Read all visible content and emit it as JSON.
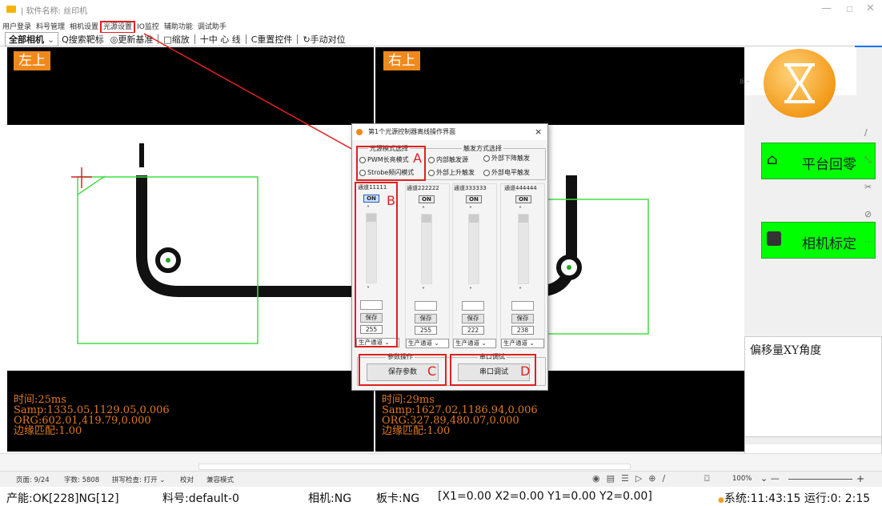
{
  "window": {
    "title": "|  软件名称: 丝印机"
  },
  "menu": [
    "用户登录",
    "料号管理",
    "相机设置",
    "光源设置",
    "IO监控",
    "辅助功能",
    "调试助手"
  ],
  "menu_active_index": 3,
  "toolbar": {
    "camera_select": "全部相机",
    "search_target": "Q搜索靶标",
    "update_base": "◎更新基准",
    "zoom": "□缩放",
    "center_line": "十中 心 线",
    "reset_ctrl": "C重置控件",
    "manual_align": "手动对位"
  },
  "cam_left": {
    "tag": "左上",
    "time": "时间:25ms",
    "samp": "Samp:1335.05,1129.05,0.006",
    "org": "ORG:602.01,419.79,0.000",
    "edge": "边缘匹配:1.00"
  },
  "cam_right": {
    "tag": "右上",
    "time": "时间:29ms",
    "samp": "Samp:1627.02,1186.94,0.006",
    "org": "ORG:327.89,480.07,0.000",
    "edge": "边缘匹配:1.00"
  },
  "right_panel": {
    "partial_label": "板 -",
    "btn_home": "平台回零",
    "btn_calib": "相机标定",
    "offset_title": "偏移量XY角度"
  },
  "dialog": {
    "title": "第1个光源控制器离线操作界面",
    "close": "×",
    "mode_group": "光源模式选择",
    "mode_pwm": "PWM长亮模式",
    "mode_strobe": "Strobe频闪模式",
    "trigger_group": "触发方式选择",
    "trig_internal": "内部触发源",
    "trig_falling": "外部下降触发",
    "trig_rising": "外部上升触发",
    "trig_level": "外部电平触发",
    "channels": [
      {
        "name": "通道11111",
        "on": "ON",
        "save": "保存",
        "value": "255",
        "prod": "生产通道"
      },
      {
        "name": "通道222222",
        "on": "ON",
        "save": "保存",
        "value": "255",
        "prod": "生产通道"
      },
      {
        "name": "通道333333",
        "on": "ON",
        "save": "保存",
        "value": "222",
        "prod": "生产通道"
      },
      {
        "name": "通道444444",
        "on": "ON",
        "save": "保存",
        "value": "238",
        "prod": "生产通道"
      }
    ],
    "param_group": "参数操作",
    "save_params": "保存参数",
    "serial_group": "串口调试",
    "serial_debug": "串口调试"
  },
  "annotations": {
    "a": "A",
    "b": "B",
    "c": "C",
    "d": "D"
  },
  "statusbar": {
    "page": "页面: 9/24",
    "words": "字数: 5808",
    "spell": "拼写检查: 打开",
    "proof": "校对",
    "compat": "兼容模式",
    "zoom": "100%"
  },
  "bottombar": {
    "result": "产能:OK[228]NG[12]",
    "material": "料号:default-0",
    "camera": "相机:NG",
    "card": "板卡:NG",
    "coords": "[X1=0.00 X2=0.00 Y1=0.00 Y2=0.00]",
    "system": "系统:11:43:15 运行:0: 2:15"
  }
}
